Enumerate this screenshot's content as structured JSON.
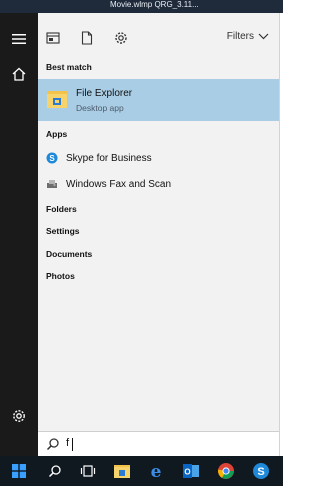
{
  "window": {
    "title_fragment": "Movie.wlmp  QRG_3.11..."
  },
  "toolbar": {
    "filters_label": "Filters"
  },
  "best_match": {
    "header": "Best match",
    "item": {
      "name": "File Explorer",
      "subtitle": "Desktop app"
    }
  },
  "apps": {
    "header": "Apps",
    "items": [
      {
        "label": "Skype for Business",
        "icon": "skype-icon"
      },
      {
        "label": "Windows Fax and Scan",
        "icon": "fax-icon"
      }
    ]
  },
  "sections": [
    "Folders",
    "Settings",
    "Documents",
    "Photos"
  ],
  "search": {
    "value": "f"
  },
  "colors": {
    "highlight": "#aacde6",
    "rail": "#1a1a1a",
    "taskbar": "#101820",
    "panel": "#f2f2f2"
  }
}
